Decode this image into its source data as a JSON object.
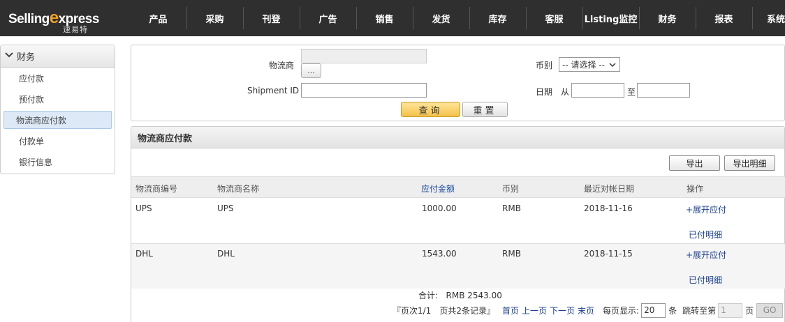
{
  "brand": {
    "name_prefix": "Selling",
    "name_x": "e",
    "name_suffix": "xpress",
    "name_cn": "速易特"
  },
  "nav": [
    "产品",
    "采购",
    "刊登",
    "广告",
    "销售",
    "发货",
    "库存",
    "客服",
    "Listing监控",
    "财务",
    "报表",
    "系统设"
  ],
  "sidebar": {
    "section": "财务",
    "items": [
      {
        "label": "应付款",
        "active": false
      },
      {
        "label": "预付款",
        "active": false
      },
      {
        "label": "物流商应付款",
        "active": true
      },
      {
        "label": "付款单",
        "active": false
      },
      {
        "label": "银行信息",
        "active": false
      }
    ]
  },
  "search": {
    "carrier_label": "物流商",
    "carrier_value": "",
    "dots_label": "...",
    "shipment_label": "Shipment ID",
    "shipment_value": "",
    "currency_label": "币别",
    "currency_selected": "-- 请选择 --",
    "date_label": "日期",
    "from_label": "从",
    "to_label": "至",
    "query_label": "查询",
    "reset_label": "重置"
  },
  "results": {
    "title": "物流商应付款",
    "export_label": "导出",
    "export_detail_label": "导出明细",
    "columns": [
      "物流商编号",
      "物流商名称",
      "应付金额",
      "币别",
      "最近对帐日期",
      "操作"
    ],
    "rows": [
      {
        "code": "UPS",
        "name": "UPS",
        "amount": "1000.00",
        "currency": "RMB",
        "date": "2018-11-16",
        "action1": "+展开应付",
        "action2": "已付明细"
      },
      {
        "code": "DHL",
        "name": "DHL",
        "amount": "1543.00",
        "currency": "RMB",
        "date": "2018-11-15",
        "action1": "+展开应付",
        "action2": "已付明细"
      }
    ],
    "total_label": "合计:",
    "total_value": "RMB 2543.00"
  },
  "pager": {
    "info": "『页次1/1　页共2条记录』",
    "first": "首页",
    "prev": "上一页",
    "next": "下一页",
    "last": "末页",
    "per_page_label": "每页显示:",
    "per_page_value": "20",
    "per_page_unit": "条",
    "jump_label": "跳转至第",
    "jump_value": "1",
    "page_unit": "页",
    "go_label": "GO"
  }
}
